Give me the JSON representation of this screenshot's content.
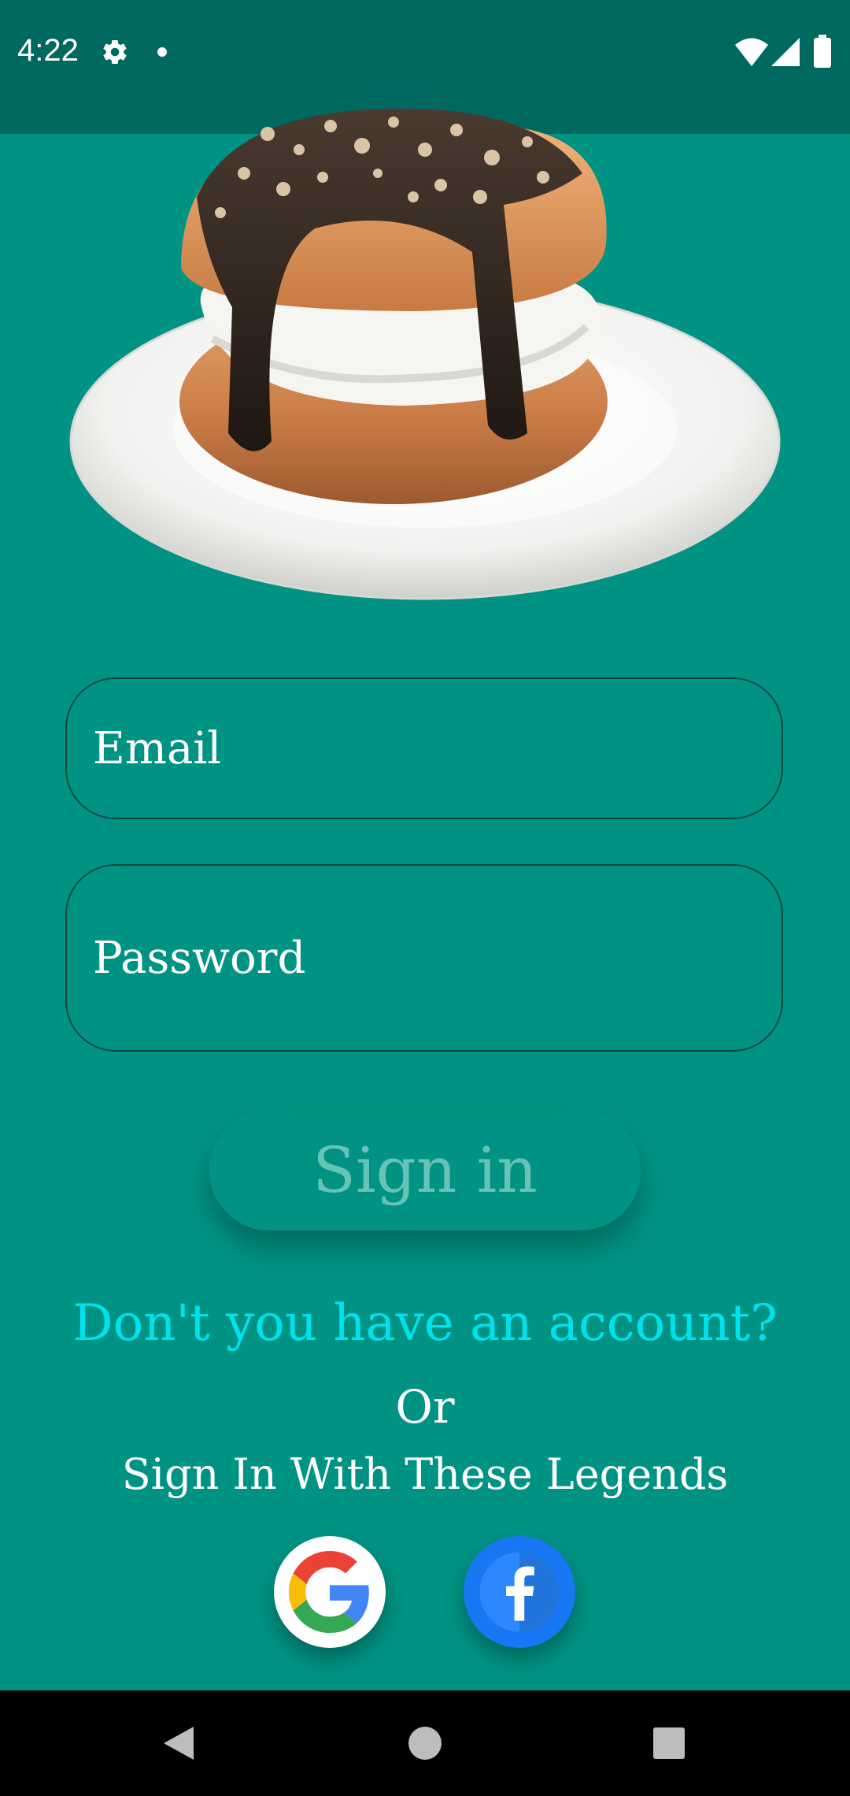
{
  "status_bar": {
    "time": "4:22",
    "icons": [
      "gear-icon",
      "notification-dot-icon",
      "wifi-icon",
      "cellular-signal-icon",
      "battery-icon"
    ]
  },
  "hero_image": {
    "subject": "cream bun with chocolate topping on a white plate"
  },
  "login_form": {
    "email_placeholder": "Email",
    "password_placeholder": "Password",
    "sign_in_label": "Sign in"
  },
  "register_link": "Don't you have an account?",
  "or_text": "Or",
  "social_heading": "Sign In With These Legends",
  "social_buttons": [
    "google-icon",
    "facebook-icon"
  ],
  "nav_bar": {
    "buttons": [
      "back-icon",
      "home-icon",
      "recents-icon"
    ]
  },
  "colors": {
    "background": "#009383",
    "status_bar": "#00695f",
    "link": "#00e1f0",
    "button_text": "#68c3b7",
    "field_border": "#0a4740",
    "facebook": "#1877f2"
  }
}
